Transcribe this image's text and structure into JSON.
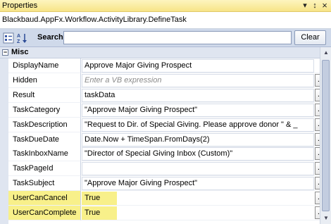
{
  "panel": {
    "title": "Properties",
    "pin": "↕",
    "dropdown": "▾",
    "close": "×"
  },
  "object_type": "Blackbaud.AppFx.Workflow.ActivityLibrary.DefineTask",
  "toolbar": {
    "search_label": "Search:",
    "search_value": "",
    "clear_label": "Clear"
  },
  "category": {
    "toggle": "−",
    "name": "Misc"
  },
  "properties": [
    {
      "name": "DisplayName",
      "value": "Approve Major Giving Prospect",
      "placeholder": false,
      "highlighted": false,
      "has_button": false
    },
    {
      "name": "Hidden",
      "value": "Enter a VB expression",
      "placeholder": true,
      "highlighted": false,
      "has_button": true
    },
    {
      "name": "Result",
      "value": "taskData",
      "placeholder": false,
      "highlighted": false,
      "has_button": true
    },
    {
      "name": "TaskCategory",
      "value": "\"Approve Major Giving Prospect\"",
      "placeholder": false,
      "highlighted": false,
      "has_button": true
    },
    {
      "name": "TaskDescription",
      "value": "\"Request to Dir. of Special Giving.  Please approve donor \" & _",
      "placeholder": false,
      "highlighted": false,
      "has_button": true
    },
    {
      "name": "TaskDueDate",
      "value": "Date.Now + TimeSpan.FromDays(2)",
      "placeholder": false,
      "highlighted": false,
      "has_button": true
    },
    {
      "name": "TaskInboxName",
      "value": "\"Director of Special Giving Inbox (Custom)\"",
      "placeholder": false,
      "highlighted": false,
      "has_button": true
    },
    {
      "name": "TaskPageId",
      "value": "",
      "placeholder": false,
      "highlighted": false,
      "has_button": true
    },
    {
      "name": "TaskSubject",
      "value": "\"Approve Major Giving Prospect\"",
      "placeholder": false,
      "highlighted": false,
      "has_button": true
    },
    {
      "name": "UserCanCancel",
      "value": "True",
      "placeholder": false,
      "highlighted": true,
      "has_button": true
    },
    {
      "name": "UserCanComplete",
      "value": "True",
      "placeholder": false,
      "highlighted": true,
      "has_button": true
    }
  ],
  "button_label": "...",
  "colors": {
    "highlight": "#f8f08a",
    "titlebar": "#f7e487",
    "toolbar": "#cfd9ea",
    "category": "#dfe5f0"
  },
  "icons": {
    "categorized": "categorized-icon",
    "alphabetical": "sort-az-icon"
  }
}
